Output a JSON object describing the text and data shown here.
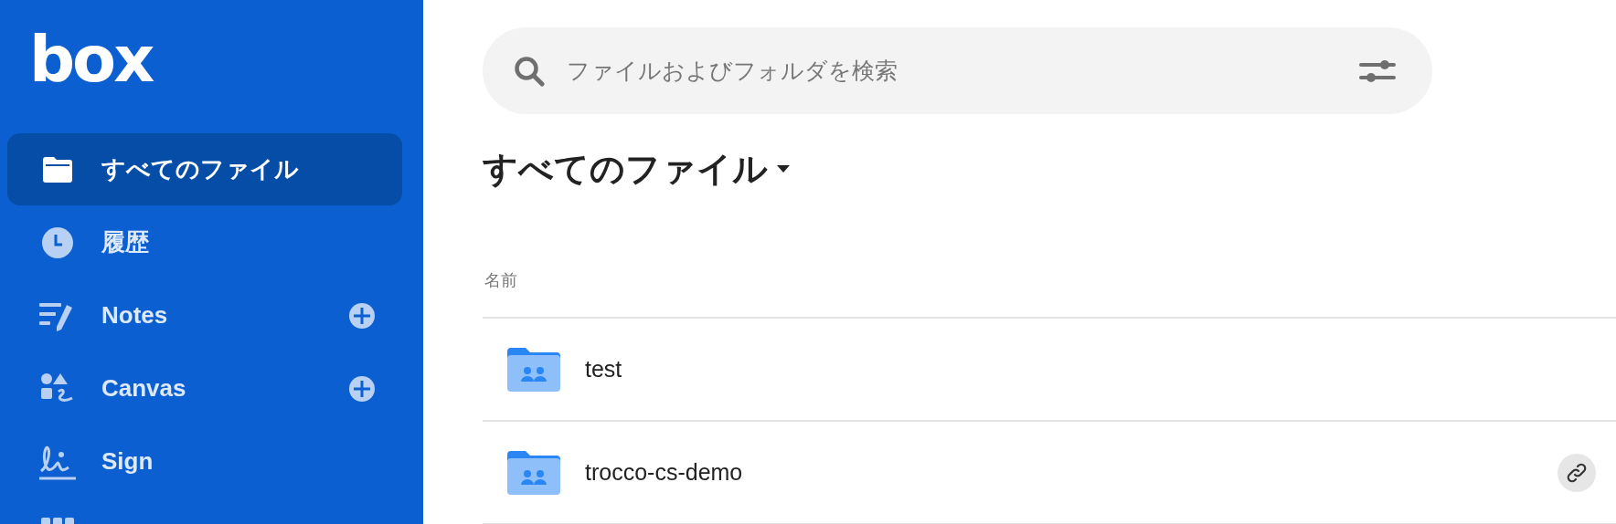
{
  "sidebar": {
    "logo": "box",
    "items": [
      {
        "kind": "folder",
        "label": "すべてのファイル",
        "selected": true,
        "add": false
      },
      {
        "kind": "clock",
        "label": "履歴",
        "selected": false,
        "add": false
      },
      {
        "kind": "notes",
        "label": "Notes",
        "selected": false,
        "add": true
      },
      {
        "kind": "canvas",
        "label": "Canvas",
        "selected": false,
        "add": true
      },
      {
        "kind": "sign",
        "label": "Sign",
        "selected": false,
        "add": false
      },
      {
        "kind": "grid",
        "selected": false,
        "add": false
      }
    ]
  },
  "search": {
    "placeholder": "ファイルおよびフォルダを検索"
  },
  "heading": {
    "title": "すべてのファイル"
  },
  "table": {
    "columns": [
      "名前"
    ],
    "rows": [
      {
        "name": "test",
        "shared_link": false
      },
      {
        "name": "trocco-cs-demo",
        "shared_link": true
      }
    ]
  }
}
